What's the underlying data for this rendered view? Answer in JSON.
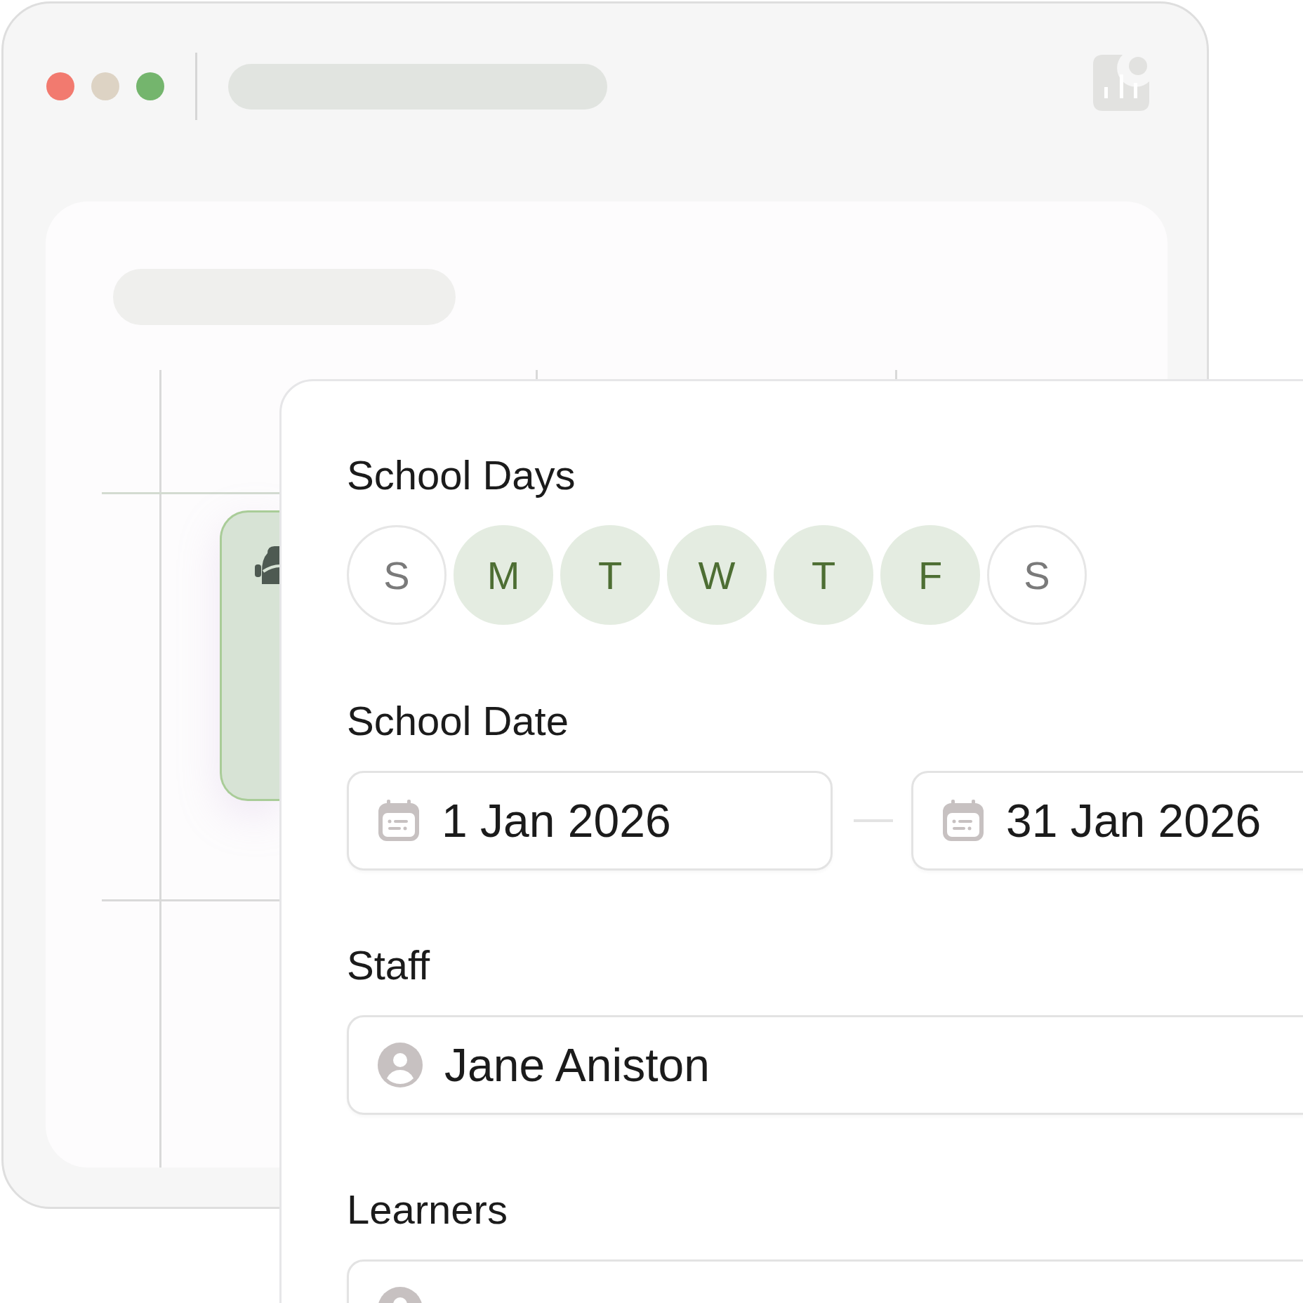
{
  "window": {
    "traffic_lights": [
      {
        "color": "#f27a6f"
      },
      {
        "color": "#ddd3c4"
      },
      {
        "color": "#74b56d"
      }
    ]
  },
  "form": {
    "school_days": {
      "label": "School Days",
      "days": [
        {
          "letter": "S",
          "selected": false
        },
        {
          "letter": "M",
          "selected": true
        },
        {
          "letter": "T",
          "selected": true
        },
        {
          "letter": "W",
          "selected": true
        },
        {
          "letter": "T",
          "selected": true
        },
        {
          "letter": "F",
          "selected": true
        },
        {
          "letter": "S",
          "selected": false
        }
      ]
    },
    "school_date": {
      "label": "School Date",
      "start": "1 Jan 2026",
      "end": "31 Jan 2026"
    },
    "staff": {
      "label": "Staff",
      "value": "Jane Aniston"
    },
    "learners": {
      "label": "Learners"
    }
  }
}
